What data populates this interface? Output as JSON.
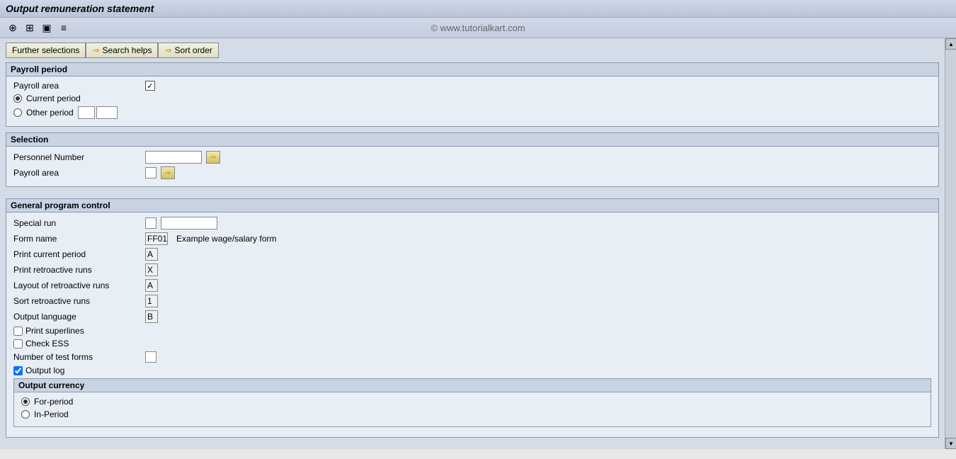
{
  "titleBar": {
    "text": "Output remuneration statement"
  },
  "watermark": "© www.tutorialkart.com",
  "toolbar": {
    "icons": [
      "⊕",
      "⊞",
      "▣",
      "≡"
    ]
  },
  "tabs": [
    {
      "id": "further-selections",
      "label": "Further selections",
      "hasArrow": false
    },
    {
      "id": "search-helps",
      "label": "Search helps",
      "hasArrow": true
    },
    {
      "id": "sort-order",
      "label": "Sort order",
      "hasArrow": true
    }
  ],
  "payrollPeriod": {
    "sectionTitle": "Payroll period",
    "fields": [
      {
        "label": "Payroll area",
        "type": "checkbox",
        "checked": true
      }
    ],
    "currentPeriodLabel": "Current period",
    "otherPeriodLabel": "Other period",
    "currentPeriodChecked": true,
    "otherPeriodChecked": false,
    "otherPeriodValues": [
      "",
      ""
    ]
  },
  "selection": {
    "sectionTitle": "Selection",
    "fields": [
      {
        "label": "Personnel Number",
        "type": "input",
        "value": "",
        "width": 60
      },
      {
        "label": "Payroll area",
        "type": "input",
        "value": "",
        "width": 18
      }
    ]
  },
  "generalProgramControl": {
    "sectionTitle": "General program control",
    "fields": [
      {
        "label": "Special run",
        "type": "dual-input",
        "val1": "",
        "val2": ""
      },
      {
        "label": "Form name",
        "type": "input-with-text",
        "value": "FF01",
        "extraText": "Example wage/salary form"
      },
      {
        "label": "Print current period",
        "type": "value",
        "value": "A"
      },
      {
        "label": "Print retroactive runs",
        "type": "value",
        "value": "X"
      },
      {
        "label": "Layout of retroactive runs",
        "type": "value",
        "value": "A"
      },
      {
        "label": "Sort retroactive runs",
        "type": "value",
        "value": "1"
      },
      {
        "label": "Output language",
        "type": "value",
        "value": "B"
      }
    ],
    "checkboxes": [
      {
        "label": "Print superlines",
        "checked": false
      },
      {
        "label": "Check ESS",
        "checked": false
      }
    ],
    "numberTestForms": {
      "label": "Number of test forms",
      "value": ""
    },
    "outputLog": {
      "label": "Output log",
      "checked": true
    },
    "outputCurrency": {
      "sectionTitle": "Output currency",
      "options": [
        {
          "label": "For-period",
          "checked": true
        },
        {
          "label": "In-Period",
          "checked": false
        }
      ]
    }
  }
}
